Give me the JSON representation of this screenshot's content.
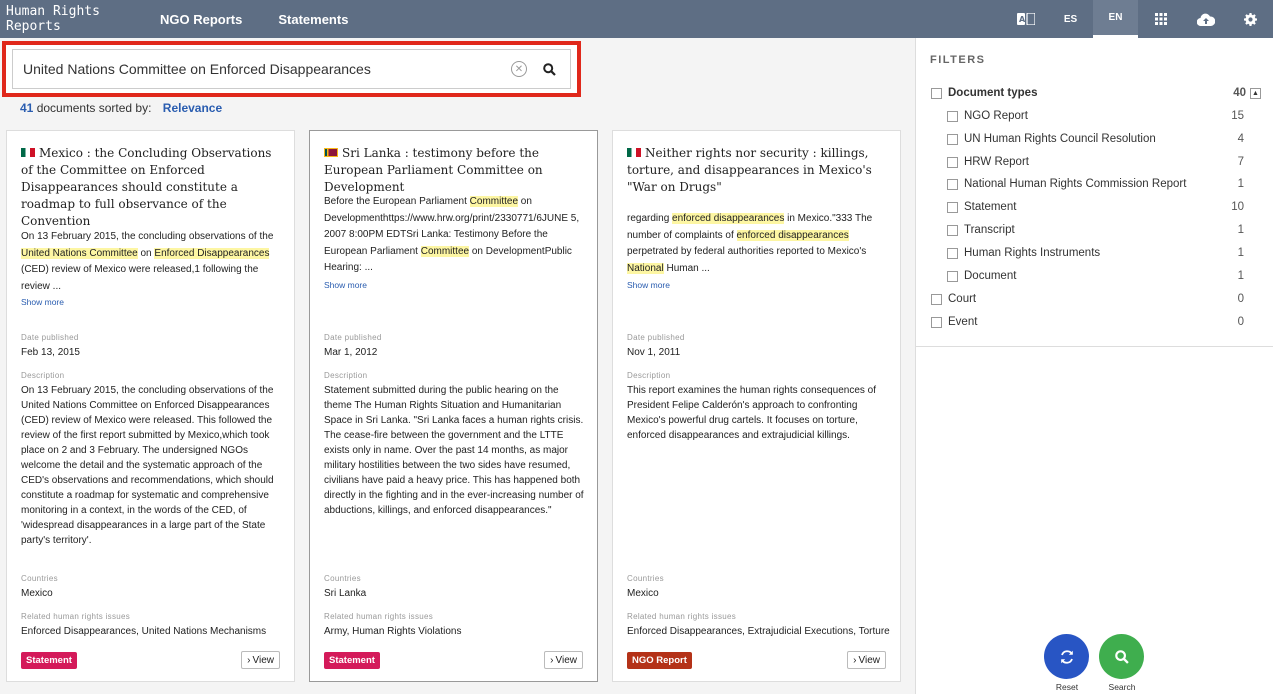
{
  "nav": {
    "brand": "Human Rights Reports",
    "links": [
      "NGO Reports",
      "Statements"
    ],
    "lang_es": "ES",
    "lang_en": "EN"
  },
  "search": {
    "value": "United Nations Committee on Enforced Disappearances"
  },
  "results": {
    "count": "41",
    "sorted_by_text": "documents sorted by:",
    "sort_value": "Relevance"
  },
  "labels": {
    "date_published": "Date published",
    "description": "Description",
    "countries": "Countries",
    "related_issues": "Related human rights issues",
    "show_more": "Show more",
    "view": "View"
  },
  "cards": [
    {
      "title": "Mexico : the Concluding Observations of the Committee on Enforced Disappearances should constitute a roadmap to full observance of the Convention",
      "snippet": [
        {
          "t": "On 13 February 2015, the concluding observations of the "
        },
        {
          "t": "United Nations Committee",
          "hl": true
        },
        {
          "t": " on "
        },
        {
          "t": "Enforced Disappearances",
          "hl": true
        },
        {
          "t": " (CED) review of Mexico were released,1 following the review ..."
        }
      ],
      "date": "Feb 13, 2015",
      "description": "On 13 February 2015, the concluding observations of the United Nations Committee on Enforced Disappearances (CED) review of Mexico were released. This followed the review of the first report submitted by Mexico,which took place on 2 and 3 February. The undersigned NGOs welcome the detail and the systematic approach of the CED's observations and recommendations, which should constitute a roadmap for systematic and comprehensive monitoring in a context, in the words of the CED, of 'widespread disappearances in a large part of the State party's territory'.",
      "countries": "Mexico",
      "issues": "Enforced Disappearances, United Nations Mechanisms",
      "type": "Statement"
    },
    {
      "title": "Sri Lanka : testimony before the European Parliament Committee on Development",
      "snippet": [
        {
          "t": "Before the European Parliament "
        },
        {
          "t": "Committee",
          "hl": true
        },
        {
          "t": " on Developmenthttps://www.hrw.org/print/2330771/6JUNE 5, 2007 8:00PM EDTSri Lanka: Testimony Before the European Parliament "
        },
        {
          "t": "Committee",
          "hl": true
        },
        {
          "t": " on DevelopmentPublic Hearing: ..."
        }
      ],
      "date": "Mar 1, 2012",
      "description": "Statement submitted during the public hearing on the theme The Human Rights Situation and Humanitarian Space in Sri Lanka. \"Sri Lanka faces a human rights crisis. The cease-fire between the government and the LTTE exists only in name. Over the past 14 months, as major military hostilities between the two sides have resumed, civilians have paid a heavy price. This has happened both directly in the fighting and in the ever-increasing number of abductions, killings, and enforced disappearances.\"",
      "countries": "Sri Lanka",
      "issues": "Army, Human Rights Violations",
      "type": "Statement"
    },
    {
      "title": "Neither rights nor security : killings, torture, and disappearances in Mexico's \"War on Drugs\"",
      "snippet": [
        {
          "t": "regarding "
        },
        {
          "t": "enforced disappearances",
          "hl": true
        },
        {
          "t": " in Mexico.\"333 The number of complaints of "
        },
        {
          "t": "enforced disappearances",
          "hl": true
        },
        {
          "t": " perpetrated by federal authorities reported to Mexico's "
        },
        {
          "t": "National",
          "hl": true
        },
        {
          "t": " Human ..."
        }
      ],
      "date": "Nov 1, 2011",
      "description": "This report examines the human rights consequences of President Felipe Calderón's approach to confronting Mexico's powerful drug cartels. It focuses on torture, enforced disappearances and extrajudicial killings.",
      "countries": "Mexico",
      "issues": "Enforced Disappearances, Extrajudicial Executions, Torture",
      "type": "NGO Report"
    }
  ],
  "filters": {
    "title": "FILTERS",
    "document_types": {
      "label": "Document types",
      "count": "40"
    },
    "subtypes": [
      {
        "label": "NGO Report",
        "count": "15"
      },
      {
        "label": "UN Human Rights Council Resolution",
        "count": "4"
      },
      {
        "label": "HRW Report",
        "count": "7"
      },
      {
        "label": "National Human Rights Commission Report",
        "count": "1"
      },
      {
        "label": "Statement",
        "count": "10"
      },
      {
        "label": "Transcript",
        "count": "1"
      },
      {
        "label": "Human Rights Instruments",
        "count": "1"
      },
      {
        "label": "Document",
        "count": "1"
      }
    ],
    "others": [
      {
        "label": "Court",
        "count": "0"
      },
      {
        "label": "Event",
        "count": "0"
      }
    ]
  },
  "actions": {
    "reset": "Reset",
    "search": "Search"
  },
  "colors": {
    "topbar": "#5e6e84",
    "highlight": "#fdf6a3",
    "statement_badge": "#d41a5a",
    "ngo_badge": "#b43218",
    "reset_fab": "#2855c4",
    "search_fab": "#3fae4e",
    "search_outline": "#e0281b"
  }
}
